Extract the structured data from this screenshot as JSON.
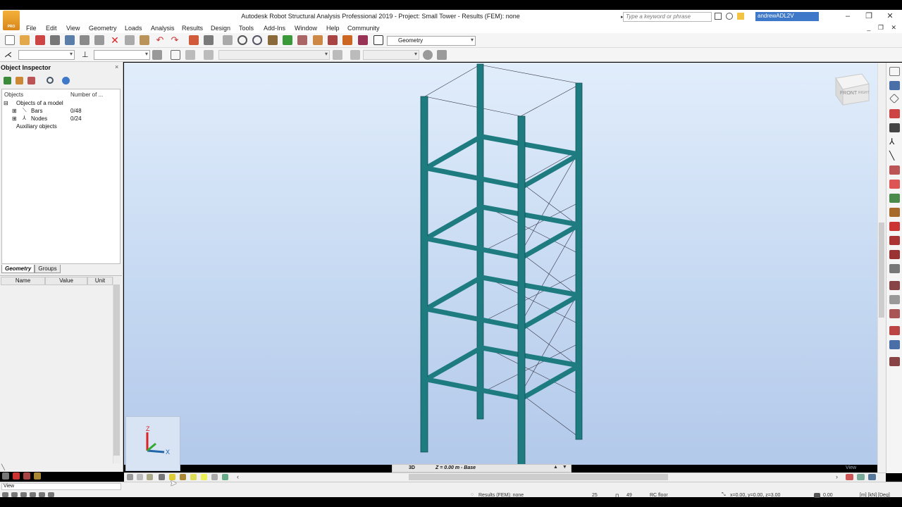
{
  "window": {
    "title": "Autodesk Robot Structural Analysis Professional 2019 - Project: Small Tower - Results (FEM): none",
    "logo_text": "PRO",
    "search_placeholder": "Type a keyword or phrase",
    "user": "andrewADL2V",
    "minimize": "–",
    "restore": "❐",
    "close": "✕",
    "mdi_controls": "_ ❐ ✕"
  },
  "menu": [
    "File",
    "Edit",
    "View",
    "Geometry",
    "Loads",
    "Analysis",
    "Results",
    "Design",
    "Tools",
    "Add-Ins",
    "Window",
    "Help",
    "Community"
  ],
  "toolbar": {
    "layout_combo": "Geometry"
  },
  "inspector": {
    "title": "Object Inspector",
    "close": "×",
    "col_objects": "Objects",
    "col_number": "Number of ...",
    "root": "Objects of a model",
    "bars_label": "Bars",
    "bars_count": "0/48",
    "nodes_label": "Nodes",
    "nodes_count": "0/24",
    "aux": "Auxiliary objects",
    "tab_geometry": "Geometry",
    "tab_groups": "Groups",
    "col_name": "Name",
    "col_value": "Value",
    "col_unit": "Unit"
  },
  "viewport": {
    "view_mode": "3D",
    "level": "Z = 0.00 m - Base",
    "watermark": "View",
    "cube_face": "FRONT",
    "cube_side": "RIGHT",
    "axis_z": "Z",
    "axis_x": "X"
  },
  "status": {
    "view_label": "View",
    "results": "Results (FEM): none",
    "num1": "25",
    "num2": "49",
    "section": "RC floor",
    "coords": "x=0.00, y=0.00, z=3.00",
    "value": "0.00",
    "units": "[m] [kN] [Deg]"
  },
  "colors": {
    "member": "#1e7c80",
    "accent": "#3e78c8"
  }
}
